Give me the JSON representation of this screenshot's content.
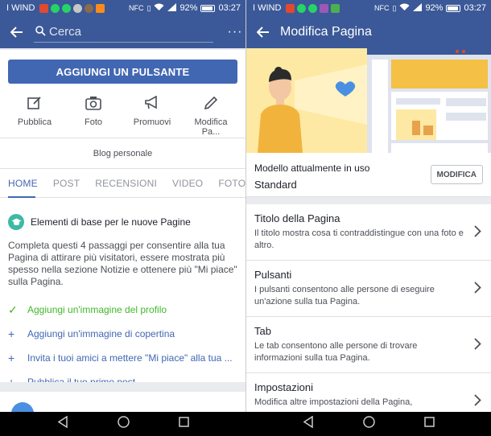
{
  "left": {
    "status": {
      "carrier": "I WIND",
      "battery": "92%",
      "time": "03:27"
    },
    "search_placeholder": "Cerca",
    "cta_label": "AGGIUNGI UN PULSANTE",
    "actions": [
      {
        "label": "Pubblica"
      },
      {
        "label": "Foto"
      },
      {
        "label": "Promuovi"
      },
      {
        "label": "Modifica Pa..."
      }
    ],
    "category": "Blog personale",
    "tabs": [
      "HOME",
      "POST",
      "RECENSIONI",
      "VIDEO",
      "FOTO"
    ],
    "card": {
      "title": "Elementi di base per le nuove Pagine",
      "description": "Completa questi 4 passaggi per consentire alla tua Pagina di attirare più visitatori, essere mostrata più spesso nella sezione Notizie e ottenere più \"Mi piace\" sulla Pagina.",
      "steps": [
        {
          "label": "Aggiungi un'immagine del profilo",
          "done": true
        },
        {
          "label": "Aggiungi un'immagine di copertina",
          "done": false
        },
        {
          "label": "Invita i tuoi amici a mettere \"Mi piace\" alla tua ...",
          "done": false
        },
        {
          "label": "Pubblica il tuo primo post",
          "done": false
        }
      ]
    }
  },
  "right": {
    "status": {
      "carrier": "I WIND",
      "battery": "92%",
      "time": "03:27"
    },
    "title": "Modifica Pagina",
    "template": {
      "label": "Modello attualmente in uso",
      "value": "Standard",
      "button": "MODIFICA"
    },
    "settings": [
      {
        "title": "Titolo della Pagina",
        "description": "Il titolo mostra cosa ti contraddistingue con una foto e altro."
      },
      {
        "title": "Pulsanti",
        "description": "I pulsanti consentono alle persone di eseguire un'azione sulla tua Pagina."
      },
      {
        "title": "Tab",
        "description": "Le tab consentono alle persone di trovare informazioni sulla tua Pagina."
      },
      {
        "title": "Impostazioni",
        "description": "Modifica altre impostazioni della Pagina,"
      }
    ]
  },
  "colors": {
    "facebook_blue": "#3b5998",
    "button_blue": "#4267b2",
    "success_green": "#42b72a"
  }
}
